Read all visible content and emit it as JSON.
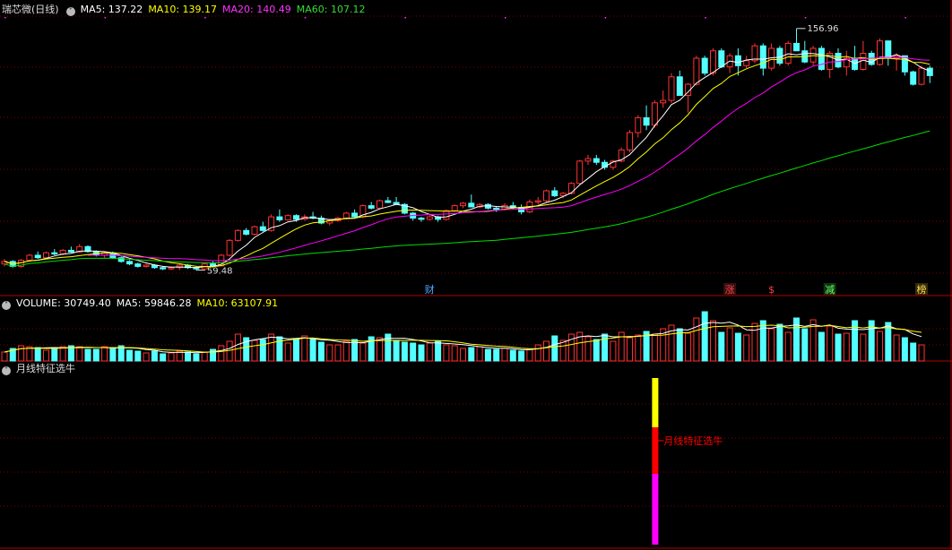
{
  "main": {
    "title": "瑞芯微(日线)",
    "ma5_label": "MA5: 137.22",
    "ma10_label": "MA10: 139.17",
    "ma20_label": "MA20: 140.49",
    "ma60_label": "MA60: 107.12",
    "high_label": "156.96",
    "low_label": "59.48",
    "event_markers": [
      {
        "text": "财",
        "color": "#4aa8ff",
        "bg": "#000"
      },
      {
        "text": "涨",
        "color": "#ff4040",
        "bg": "#331010"
      },
      {
        "text": "$",
        "color": "#ff4040",
        "bg": "#000"
      },
      {
        "text": "减",
        "color": "#66ff66",
        "bg": "#103310"
      },
      {
        "text": "榜",
        "color": "#ffdd44",
        "bg": "#332a10"
      }
    ]
  },
  "volume": {
    "label": "VOLUME: 30749.40",
    "ma5_label": "MA5: 59846.28",
    "ma10_label": "MA10: 63107.91"
  },
  "indicator": {
    "title": "月线特征选牛",
    "signal_label": "月线特征选牛"
  },
  "colors": {
    "up": "#ff3232",
    "down": "#54ffff",
    "ma5": "#ffffff",
    "ma10": "#ffff00",
    "ma20": "#ff00ff",
    "ma60": "#00dd00",
    "grid": "#7a0000",
    "border": "#b00000",
    "signal_yellow": "#ffff00",
    "signal_red": "#ff0000",
    "signal_magenta": "#ff00ff"
  },
  "chart_data": {
    "type": "candlestick",
    "price_axis": {
      "ylim": [
        55,
        162
      ]
    },
    "candles": [
      [
        62,
        64,
        61,
        63
      ],
      [
        63,
        63.5,
        60.5,
        61
      ],
      [
        61,
        64,
        60.5,
        63.5
      ],
      [
        63.5,
        66,
        63,
        65.5
      ],
      [
        65.5,
        67,
        64,
        64.5
      ],
      [
        64.5,
        67,
        64,
        66.5
      ],
      [
        66.5,
        68,
        65.5,
        66
      ],
      [
        66,
        68,
        65.5,
        67.5
      ],
      [
        67.5,
        69,
        66.5,
        66.8
      ],
      [
        66.8,
        70,
        66.5,
        69
      ],
      [
        69,
        69.5,
        66.5,
        67
      ],
      [
        67,
        67.5,
        65,
        65.5
      ],
      [
        65.5,
        67,
        64.5,
        66.5
      ],
      [
        66.5,
        67,
        64,
        64.5
      ],
      [
        64.5,
        65,
        62.5,
        63
      ],
      [
        63,
        63.5,
        61.5,
        62
      ],
      [
        62,
        62.5,
        60.5,
        61
      ],
      [
        61,
        62,
        60.5,
        61.5
      ],
      [
        61.5,
        62,
        60,
        60.5
      ],
      [
        60.5,
        61,
        59.5,
        60
      ],
      [
        60,
        61,
        59.5,
        60.5
      ],
      [
        60.5,
        62,
        59.5,
        61.5
      ],
      [
        61.5,
        62,
        60,
        60.5
      ],
      [
        60.5,
        61,
        59.48,
        60
      ],
      [
        60,
        62.5,
        59.8,
        62
      ],
      [
        62,
        63,
        60.5,
        61.2
      ],
      [
        61.2,
        66,
        61,
        65.5
      ],
      [
        65.5,
        72,
        65,
        71.5
      ],
      [
        71.5,
        76,
        71,
        75.5
      ],
      [
        75.5,
        76.5,
        73.5,
        74
      ],
      [
        74,
        77.5,
        73.5,
        77
      ],
      [
        77,
        79,
        75,
        75.5
      ],
      [
        75.5,
        82,
        75,
        81
      ],
      [
        81,
        84,
        79,
        79.8
      ],
      [
        79.8,
        82,
        79.5,
        81.5
      ],
      [
        81.5,
        82,
        79,
        80
      ],
      [
        80,
        82,
        79.5,
        81
      ],
      [
        81,
        83,
        80,
        80.5
      ],
      [
        80.5,
        81.5,
        78,
        78.5
      ],
      [
        78.5,
        80,
        77.5,
        79.5
      ],
      [
        79.5,
        81,
        79,
        80.5
      ],
      [
        80.5,
        83,
        80,
        82.5
      ],
      [
        82.5,
        84,
        80.5,
        81
      ],
      [
        81,
        86,
        80.5,
        85.5
      ],
      [
        85.5,
        87,
        84,
        84.5
      ],
      [
        84.5,
        88,
        84,
        87.5
      ],
      [
        87.5,
        89,
        86.5,
        86.8
      ],
      [
        86.8,
        89,
        86,
        86
      ],
      [
        86,
        86.5,
        82,
        82.5
      ],
      [
        82.5,
        83,
        79.5,
        80.5
      ],
      [
        80.5,
        81,
        79,
        80
      ],
      [
        80,
        82,
        79.5,
        81
      ],
      [
        81,
        81.5,
        79,
        80
      ],
      [
        80,
        84,
        79.5,
        83.5
      ],
      [
        83.5,
        86,
        83,
        85.5
      ],
      [
        85.5,
        87,
        84.5,
        86.5
      ],
      [
        86.5,
        90,
        85.5,
        85
      ],
      [
        85,
        86.5,
        84.5,
        86
      ],
      [
        86,
        86.5,
        84,
        84.5
      ],
      [
        84.5,
        85,
        83,
        84
      ],
      [
        84,
        86.5,
        83.5,
        85.5
      ],
      [
        85.5,
        87,
        84,
        84.8
      ],
      [
        84.8,
        86,
        82,
        83
      ],
      [
        83,
        88,
        82.5,
        87
      ],
      [
        87,
        89,
        86,
        87.5
      ],
      [
        87.5,
        92,
        87,
        91.5
      ],
      [
        91.5,
        93,
        89,
        89.5
      ],
      [
        89.5,
        91,
        88.5,
        90.5
      ],
      [
        90.5,
        95,
        90,
        94.5
      ],
      [
        94.5,
        104,
        94,
        103.5
      ],
      [
        103.5,
        106,
        102,
        104.5
      ],
      [
        104.5,
        106,
        102,
        103
      ],
      [
        103,
        104,
        100,
        101
      ],
      [
        101,
        104,
        100,
        103.5
      ],
      [
        103.5,
        109,
        103,
        108
      ],
      [
        108,
        116,
        107,
        115
      ],
      [
        115,
        122,
        113,
        121
      ],
      [
        121,
        126,
        116,
        118
      ],
      [
        118,
        128,
        117,
        127
      ],
      [
        127,
        132,
        125,
        128
      ],
      [
        128,
        139,
        127,
        137.5
      ],
      [
        137.5,
        140,
        130,
        130
      ],
      [
        130,
        135,
        123,
        134.5
      ],
      [
        134.5,
        146,
        134,
        145
      ],
      [
        145,
        146,
        138,
        139
      ],
      [
        139,
        149,
        138,
        148
      ],
      [
        148,
        149,
        141,
        141.5
      ],
      [
        141.5,
        147,
        139,
        146
      ],
      [
        146,
        149,
        138,
        142
      ],
      [
        142,
        146,
        141,
        144
      ],
      [
        144,
        151,
        143,
        150
      ],
      [
        150,
        151,
        138,
        141
      ],
      [
        141,
        151,
        140,
        149
      ],
      [
        149,
        150,
        142,
        143
      ],
      [
        143,
        152,
        142,
        151
      ],
      [
        151,
        157,
        150,
        148
      ],
      [
        148,
        152,
        143,
        143.5
      ],
      [
        143.5,
        150,
        142,
        149
      ],
      [
        149,
        150,
        140,
        140.5
      ],
      [
        140.5,
        148,
        137,
        147
      ],
      [
        147,
        149,
        141,
        141.5
      ],
      [
        141.5,
        148,
        138,
        145
      ],
      [
        145,
        150,
        140,
        140.5
      ],
      [
        140.5,
        152,
        140,
        147
      ],
      [
        147,
        148,
        142,
        142.5
      ],
      [
        142.5,
        153,
        142,
        152
      ],
      [
        152,
        152,
        142,
        145
      ],
      [
        145,
        147,
        140,
        146
      ],
      [
        146,
        146,
        138,
        139.5
      ],
      [
        139.5,
        140,
        134,
        134.5
      ],
      [
        134.5,
        142,
        134,
        141
      ],
      [
        141,
        142,
        135,
        138
      ]
    ],
    "volume": [
      10,
      14,
      17,
      16,
      15,
      12,
      15,
      16,
      17,
      16,
      13,
      13,
      16,
      15,
      17,
      12,
      11,
      9,
      11,
      8,
      9,
      11,
      10,
      8,
      10,
      13,
      17,
      22,
      30,
      26,
      23,
      24,
      30,
      27,
      20,
      25,
      28,
      24,
      21,
      18,
      18,
      22,
      24,
      20,
      27,
      26,
      30,
      23,
      21,
      20,
      18,
      20,
      22,
      18,
      17,
      14,
      15,
      16,
      13,
      13,
      14,
      12,
      11,
      13,
      18,
      22,
      28,
      23,
      30,
      32,
      27,
      24,
      30,
      22,
      32,
      26,
      29,
      33,
      30,
      36,
      40,
      36,
      31,
      48,
      55,
      45,
      32,
      37,
      31,
      29,
      42,
      45,
      36,
      41,
      32,
      48,
      36,
      46,
      32,
      39,
      30,
      31,
      45,
      30,
      45,
      33,
      43,
      29,
      26,
      20,
      18
    ],
    "series": [
      {
        "name": "MA5",
        "color": "ma5"
      },
      {
        "name": "MA10",
        "color": "ma10"
      },
      {
        "name": "MA20",
        "color": "ma20"
      },
      {
        "name": "MA60",
        "color": "ma60"
      }
    ],
    "signal": {
      "bar_index": 78,
      "segments": [
        "yellow",
        "red",
        "magenta"
      ]
    }
  }
}
